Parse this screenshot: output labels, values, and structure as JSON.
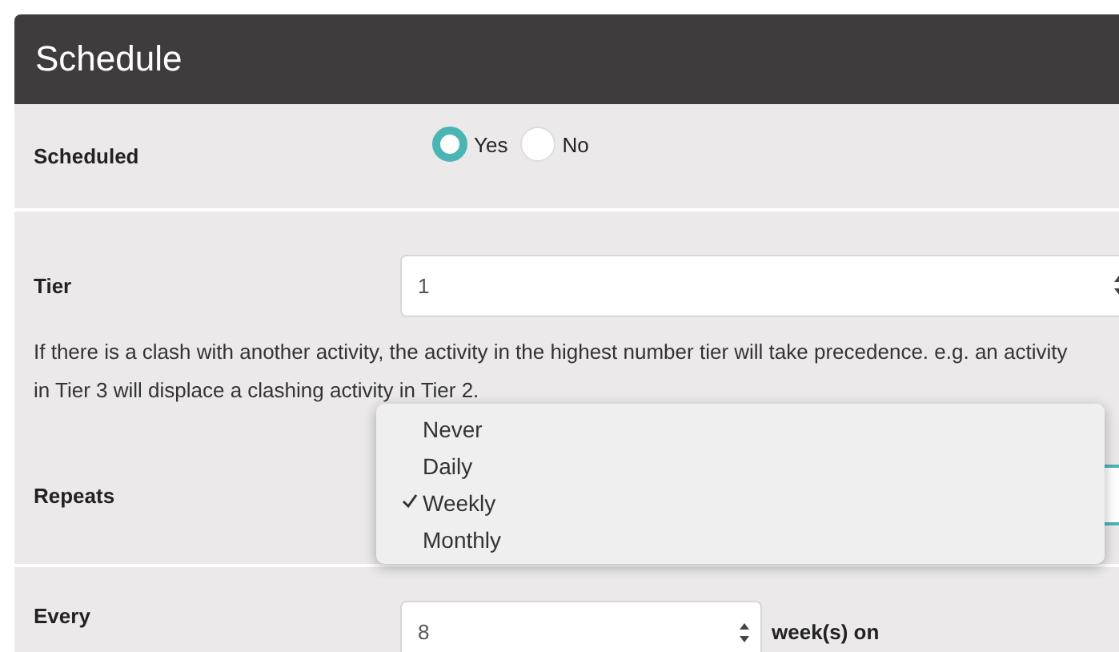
{
  "header": {
    "title": "Schedule"
  },
  "scheduled": {
    "label": "Scheduled",
    "options": [
      {
        "label": "Yes",
        "selected": true
      },
      {
        "label": "No",
        "selected": false
      }
    ]
  },
  "tier": {
    "label": "Tier",
    "value": "1",
    "help": "If there is a clash with another activity, the activity in the highest number tier will take precedence. e.g. an activity in Tier 3 will displace a clashing activity in Tier 2."
  },
  "repeats": {
    "label": "Repeats",
    "menu": [
      {
        "label": "Never",
        "selected": false
      },
      {
        "label": "Daily",
        "selected": false
      },
      {
        "label": "Weekly",
        "selected": true
      },
      {
        "label": "Monthly",
        "selected": false
      }
    ]
  },
  "every": {
    "label": "Every",
    "value": "8",
    "suffix": "week(s) on"
  }
}
